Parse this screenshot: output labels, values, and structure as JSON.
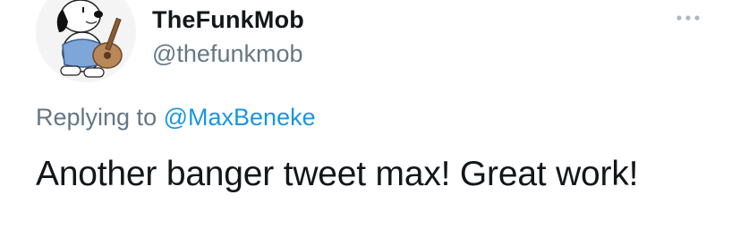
{
  "user": {
    "display_name": "TheFunkMob",
    "handle": "@thefunkmob",
    "avatar_icon": "snoopy-playing-guitar-avatar"
  },
  "more_icon": "ellipsis-icon",
  "reply": {
    "prefix": "Replying to",
    "mention": "@MaxBeneke"
  },
  "tweet": {
    "text": "Another banger tweet max! Great work!"
  },
  "colors": {
    "name": "#14171a",
    "secondary": "#657786",
    "link": "#1b95e0",
    "background": "#ffffff"
  }
}
